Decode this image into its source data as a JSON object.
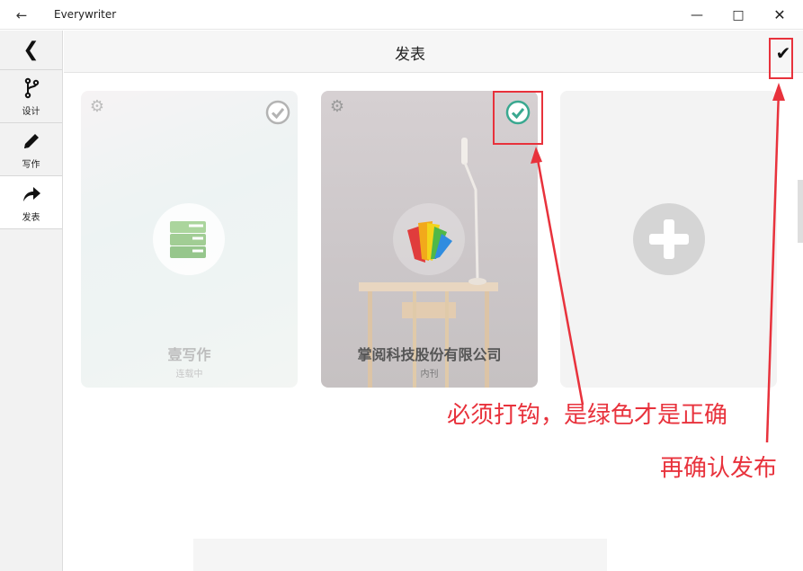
{
  "window": {
    "title": "Everywriter",
    "back_icon": "arrow-left-icon",
    "minimize_icon": "minimize-icon",
    "maximize_icon": "maximize-icon",
    "close_icon": "close-icon"
  },
  "sidebar": {
    "back_icon": "chevron-left-icon",
    "items": [
      {
        "label": "设计",
        "icon": "branch-icon"
      },
      {
        "label": "写作",
        "icon": "pencil-icon"
      },
      {
        "label": "发表",
        "icon": "share-icon",
        "active": true
      }
    ]
  },
  "header": {
    "title": "发表",
    "confirm_icon": "checkmark-icon"
  },
  "cards": [
    {
      "name": "壹写作",
      "status": "连载中",
      "selected": false,
      "logo": "books-icon"
    },
    {
      "name": "掌阅科技股份有限公司",
      "status": "内刊",
      "selected": true,
      "logo": "ireader-icon"
    },
    {
      "name": "",
      "status": "",
      "add": true,
      "logo": "plus-icon"
    }
  ],
  "annotations": {
    "note1": "必须打钩，是绿色才是正确",
    "note2": "再确认发布"
  },
  "colors": {
    "selected_check": "#3aa890",
    "annotation_red": "#e8323c",
    "unselected_check": "#9a9a9a"
  }
}
